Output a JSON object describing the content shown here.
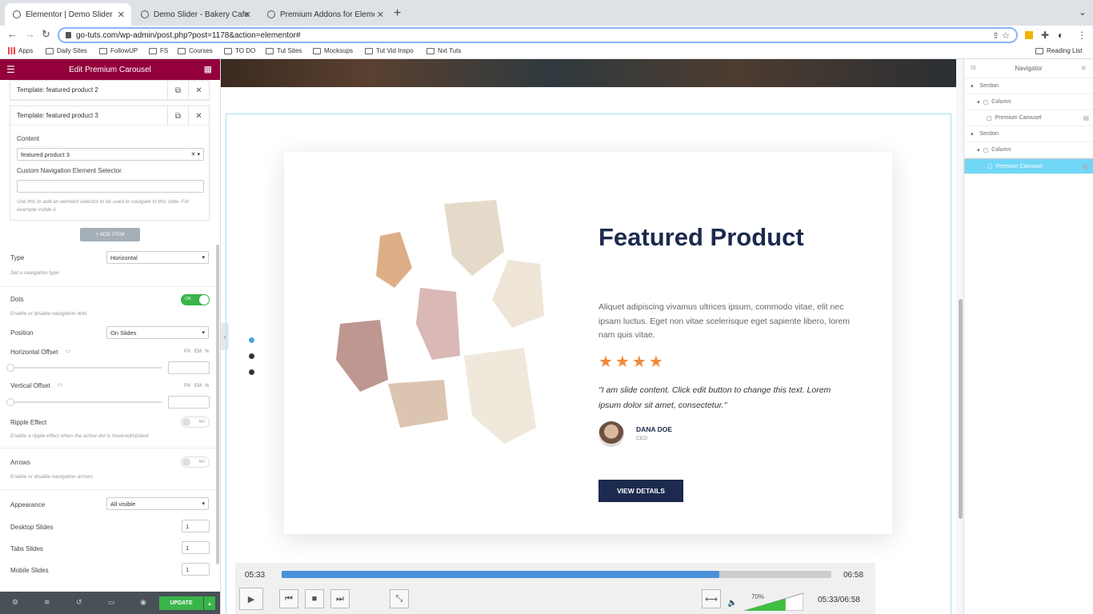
{
  "browser": {
    "tabs": [
      {
        "title": "Elementor | Demo Slider",
        "active": true
      },
      {
        "title": "Demo Slider - Bakery Cafe",
        "active": false
      },
      {
        "title": "Premium Addons for Elementor",
        "active": false
      }
    ],
    "new_tab": "+",
    "url": "go-tuts.com/wp-admin/post.php?post=1178&action=elementor#",
    "bookmarks": [
      "Apps",
      "Daily Sites",
      "FollowUP",
      "FS",
      "Courses",
      "TO DO",
      "Tut Sites",
      "Mocksups",
      "Tut Vid Inspo",
      "Nxt Tuts"
    ],
    "reading_list": "Reading List"
  },
  "panel": {
    "title": "Edit Premium Carousel",
    "templates": [
      {
        "label": "Template: featured product 2"
      },
      {
        "label": "Template: featured product 3"
      }
    ],
    "content_label": "Content",
    "content_value": "featured product 3",
    "custom_nav_label": "Custom Navigation Element Selector",
    "custom_nav_hint": "Use this to add an element selector to be used to navigate to this slide. For example #slide-1",
    "add_item": "+ ADD ITEM",
    "type_label": "Type",
    "type_value": "Horizontal",
    "type_hint": "Set a navigation type",
    "dots_label": "Dots",
    "dots_state": "ON",
    "dots_hint": "Enable or disable navigation dots",
    "position_label": "Position",
    "position_value": "On Slides",
    "h_offset_label": "Horizontal Offset",
    "v_offset_label": "Vertical Offset",
    "unit_px": "PX",
    "unit_em": "EM",
    "unit_pct": "%",
    "ripple_label": "Ripple Effect",
    "ripple_state": "NO",
    "ripple_hint": "Enable a ripple effect when the active dot is hovered/clicked",
    "arrows_label": "Arrows",
    "arrows_state": "NO",
    "arrows_hint": "Enable or disable navigation arrows",
    "appearance_label": "Appearance",
    "appearance_value": "All visible",
    "desktop_label": "Desktop Slides",
    "desktop_value": "1",
    "tabs_label": "Tabs Slides",
    "tabs_value": "1",
    "mobile_label": "Mobile Slides",
    "mobile_value": "1",
    "update": "UPDATE"
  },
  "canvas": {
    "title": "Featured Product",
    "description": "Aliquet adipiscing vivamus ultrices ipsum, commodo vitae, elit nec ipsam luctus. Eget non vitae scelerisque eget sapiente libero, lorem nam quis vitae.",
    "rating": 4,
    "quote": "\"I am slide content. Click edit button to change this text. Lorem ipsum dolor sit amet, consectetur.\"",
    "person_name": "DANA DOE",
    "person_role": "CEO",
    "button": "VIEW DETAILS",
    "dot_count": 3,
    "active_dot": 0
  },
  "player": {
    "current": "05:33",
    "total": "06:58",
    "progress": 0.796,
    "combined": "05:33/06:58",
    "volume_pct": "70%",
    "volume": 0.7
  },
  "navigator": {
    "title": "Navigator",
    "rows": [
      {
        "label": "Section",
        "level": 0,
        "selected": false
      },
      {
        "label": "Column",
        "level": 1,
        "selected": false
      },
      {
        "label": "Premium Carousel",
        "level": 2,
        "selected": false
      },
      {
        "label": "Section",
        "level": 0,
        "selected": false
      },
      {
        "label": "Column",
        "level": 1,
        "selected": false
      },
      {
        "label": "Premium Carousel",
        "level": 2,
        "selected": true
      }
    ]
  },
  "colors": {
    "panel_header": "#93003c",
    "accent_blue": "#4a90d9",
    "navy": "#1b2a4e",
    "star": "#f0883a",
    "update_green": "#39b54a",
    "nav_selected": "#71d7f7"
  }
}
